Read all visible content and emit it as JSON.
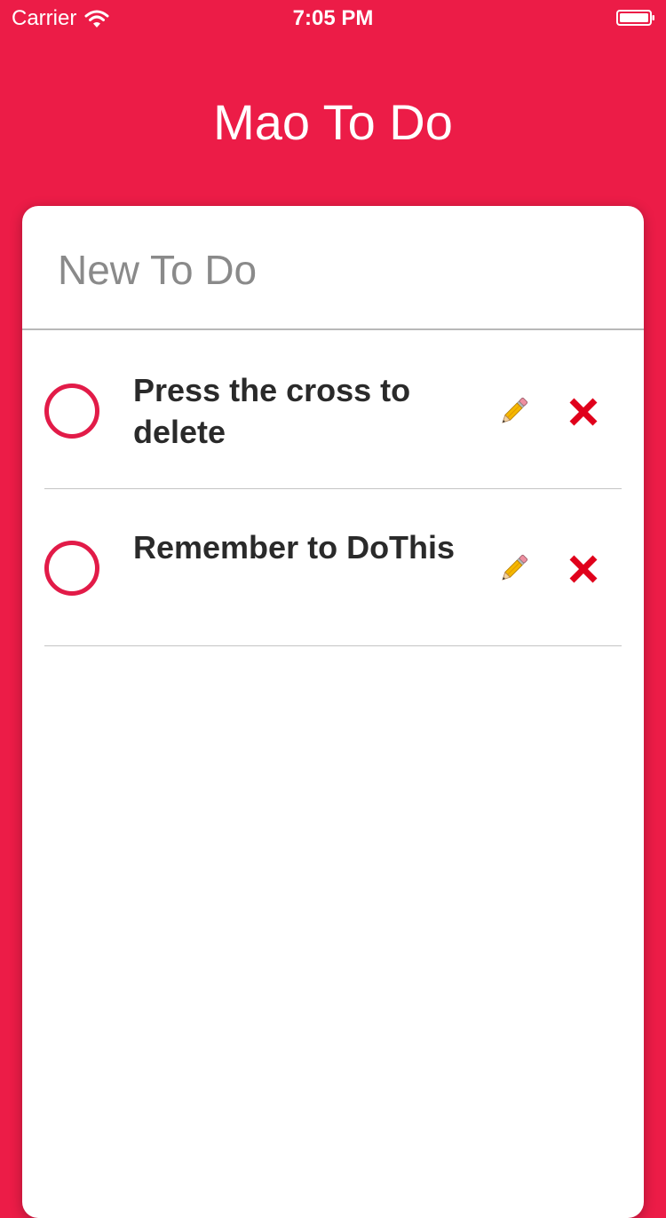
{
  "status_bar": {
    "carrier": "Carrier",
    "time": "7:05 PM"
  },
  "header": {
    "title": "Mao To Do"
  },
  "new_todo": {
    "placeholder": "New To Do",
    "value": ""
  },
  "todos": [
    {
      "text": "Press the cross to delete",
      "completed": false,
      "edit_icon": "pencil-icon",
      "delete_icon": "cross-icon"
    },
    {
      "text": "Remember to DoThis",
      "completed": false,
      "edit_icon": "pencil-icon",
      "delete_icon": "cross-icon"
    }
  ],
  "colors": {
    "accent": "#EC1C47",
    "check_ring": "#E21B48",
    "delete": "#E0001B"
  }
}
